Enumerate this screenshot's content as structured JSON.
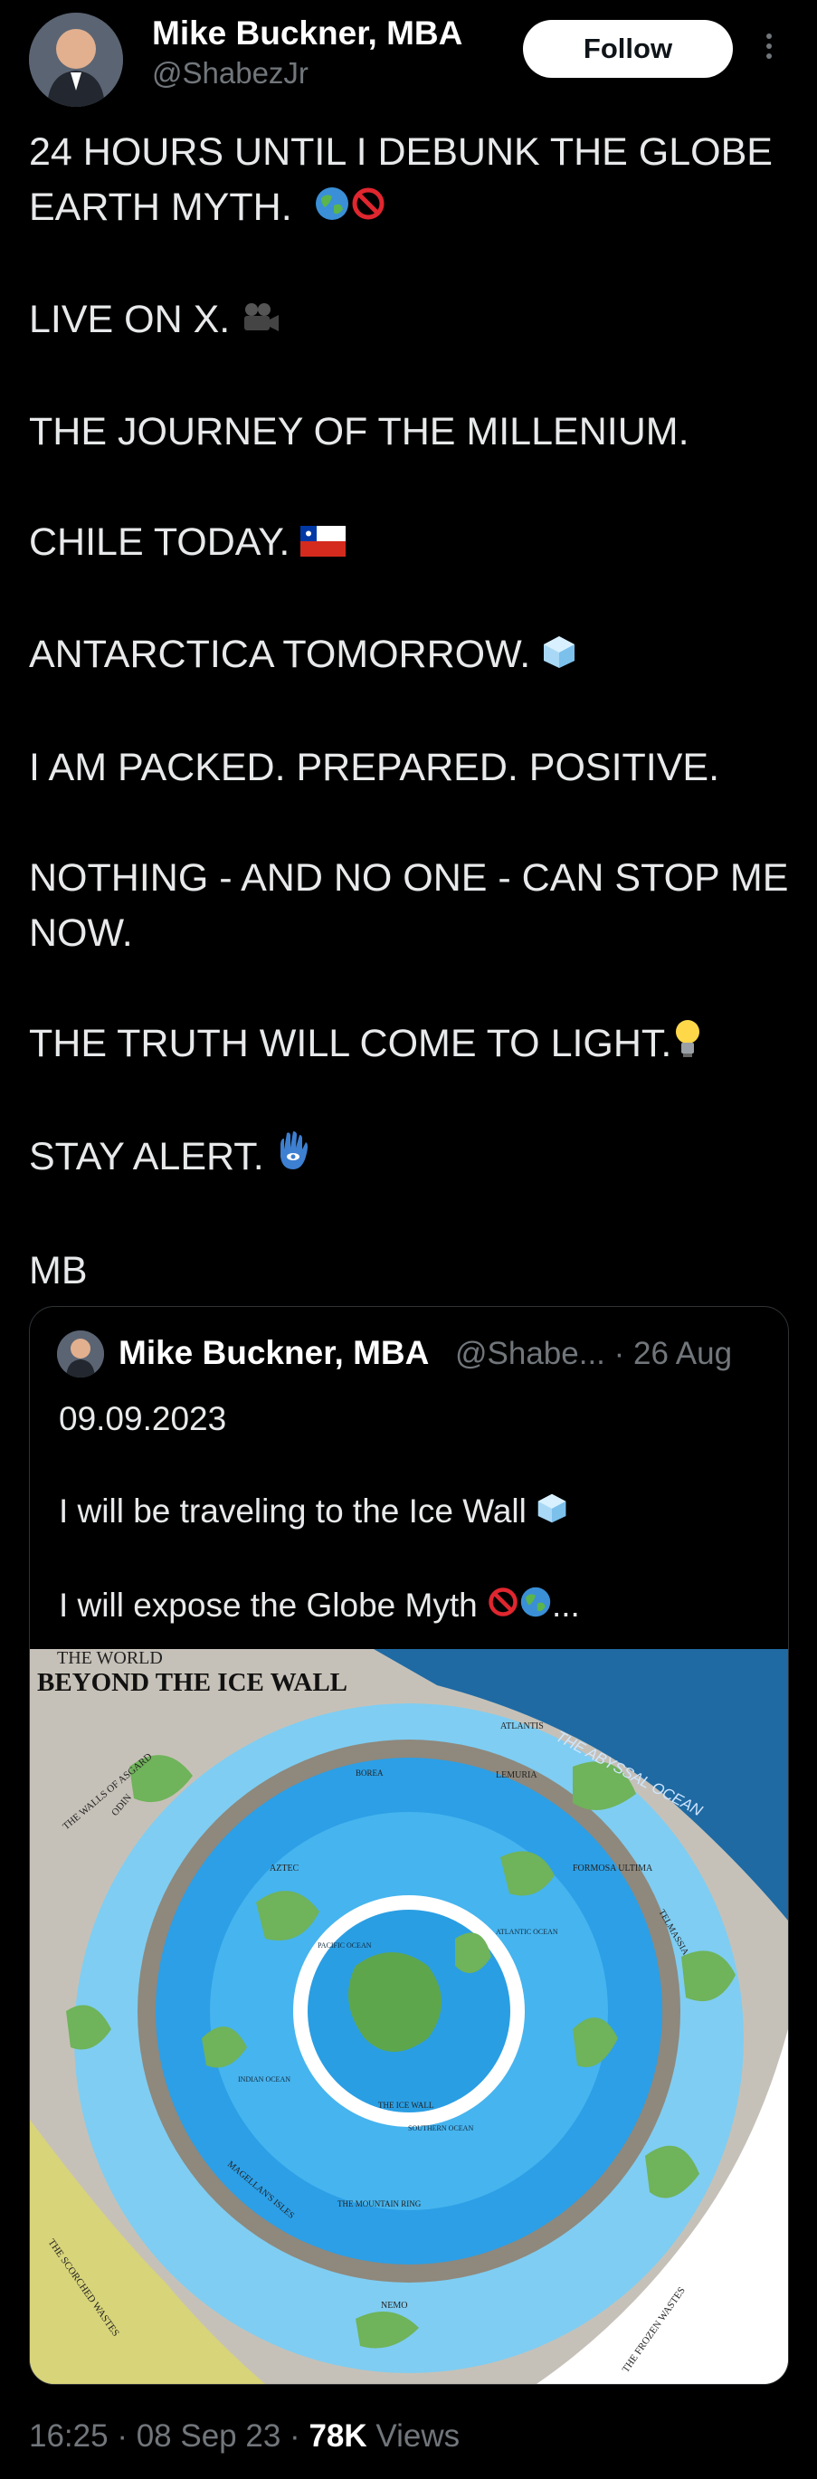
{
  "author": {
    "name": "Mike Buckner, MBA",
    "handle": "@ShabezJr"
  },
  "follow_label": "Follow",
  "post_paragraphs": [
    "24 HOURS UNTIL I DEBUNK THE GLOBE EARTH MYTH.",
    "LIVE ON X.",
    "THE JOURNEY OF THE MILLENIUM.",
    "CHILE TODAY.",
    "ANTARCTICA TOMORROW.",
    "I AM PACKED. PREPARED. POSITIVE.",
    "NOTHING - AND NO ONE - CAN STOP ME NOW.",
    "THE TRUTH WILL COME TO LIGHT.",
    "STAY ALERT.",
    "MB"
  ],
  "quoted": {
    "name": "Mike Buckner, MBA",
    "handle_trunc": "@Shabe...",
    "date": "26 Aug",
    "lines": [
      "09.09.2023",
      "I will be traveling to the Ice Wall",
      "I will expose the Globe Myth"
    ],
    "ellipsis": "...",
    "map": {
      "title_small": "THE WORLD",
      "title_big": "BEYOND THE ICE WALL",
      "labels": [
        "THE ABYSSAL OCEAN",
        "THE WALLS OF ASGARD",
        "ODIN",
        "ATLANTIS",
        "LEMURIA",
        "AZTEC",
        "FORMOSA ULTIMA",
        "TELMASSIA",
        "MAGELLAN'S ISLES",
        "NEMO",
        "THE SCORCHED WASTES",
        "THE FROZEN WASTES",
        "THE ICE WALL",
        "THE MOUNTAIN RING",
        "PACIFIC OCEAN",
        "ATLANTIC OCEAN",
        "INDIAN OCEAN",
        "SOUTHERN OCEAN",
        "BOREA"
      ]
    }
  },
  "footer": {
    "time": "16:25",
    "date": "08 Sep 23",
    "views_count": "78K",
    "views_label": "Views",
    "sep": "·"
  },
  "colors": {
    "accent": "#1d9bf0",
    "muted": "#71767b"
  }
}
